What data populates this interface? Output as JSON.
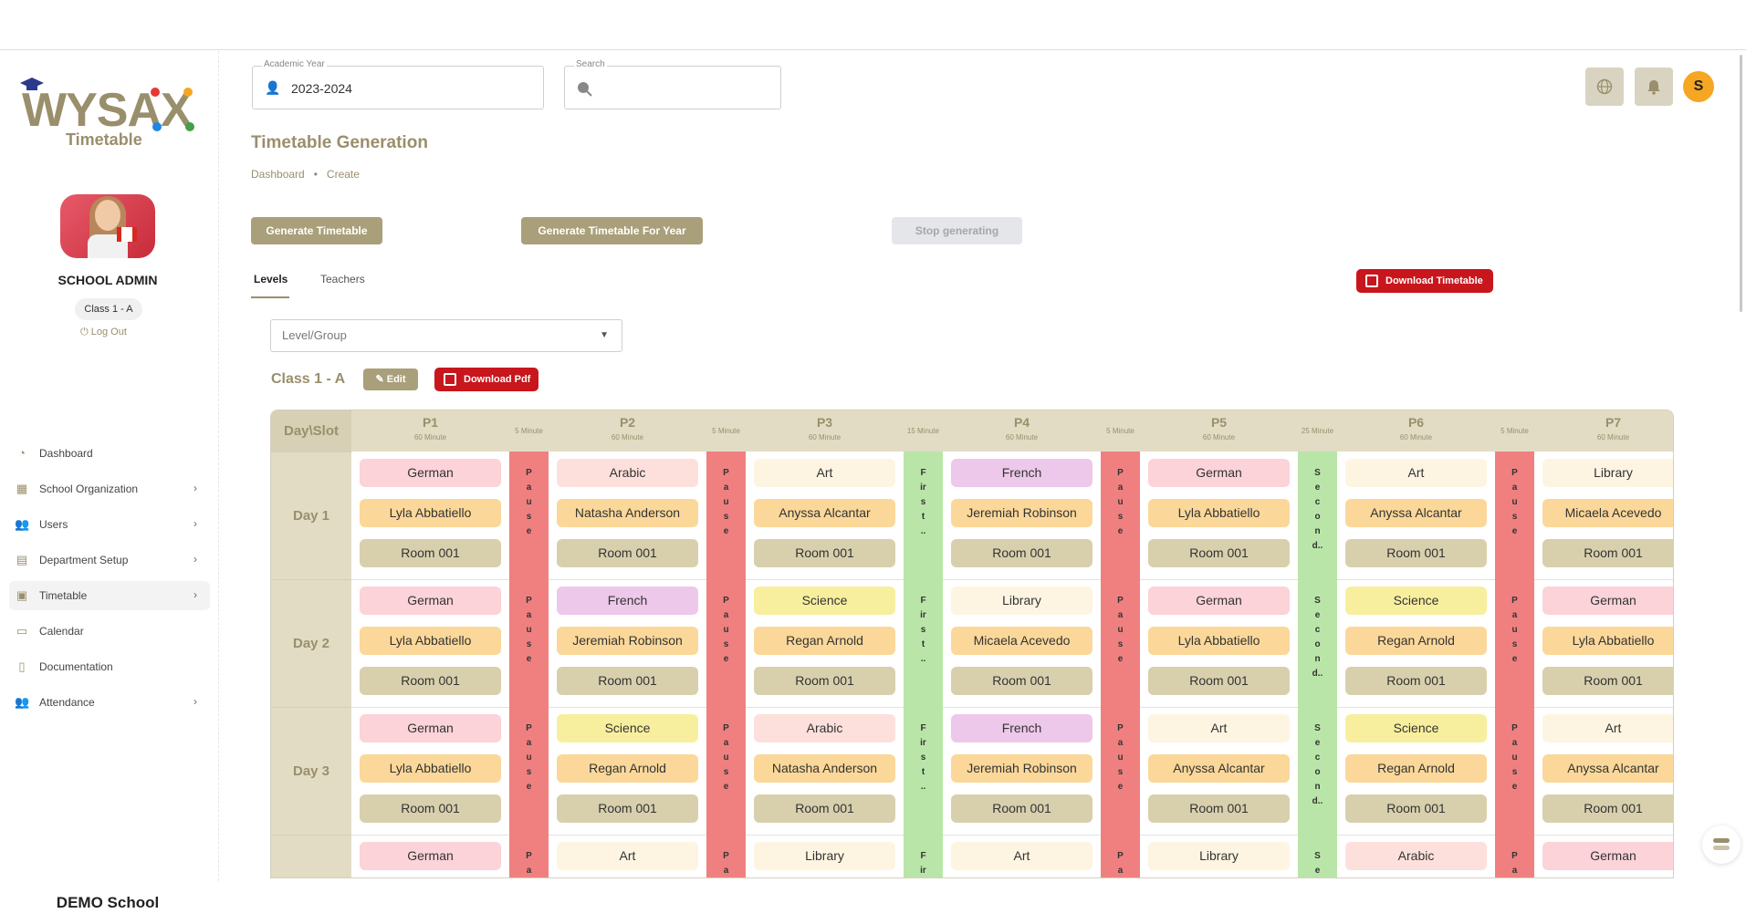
{
  "brand": {
    "logo_text": "WYSAX",
    "logo_sub": "Timetable",
    "school": "DEMO School"
  },
  "profile": {
    "role": "SCHOOL ADMIN",
    "class_chip": "Class 1 - A",
    "logout": "Log Out"
  },
  "nav": [
    {
      "label": "Dashboard",
      "icon": "dashboard-icon",
      "chevron": false
    },
    {
      "label": "School Organization",
      "icon": "building-icon",
      "chevron": true
    },
    {
      "label": "Users",
      "icon": "users-icon",
      "chevron": true
    },
    {
      "label": "Department Setup",
      "icon": "department-icon",
      "chevron": true
    },
    {
      "label": "Timetable",
      "icon": "timetable-icon",
      "chevron": true,
      "active": true
    },
    {
      "label": "Calendar",
      "icon": "calendar-icon",
      "chevron": false
    },
    {
      "label": "Documentation",
      "icon": "document-icon",
      "chevron": false
    },
    {
      "label": "Attendance",
      "icon": "attendance-icon",
      "chevron": true
    }
  ],
  "header": {
    "academic_year_label": "Academic Year",
    "academic_year_value": "2023-2024",
    "search_label": "Search",
    "avatar_initial": "S"
  },
  "page": {
    "title": "Timetable Generation",
    "breadcrumb": [
      "Dashboard",
      "Create"
    ],
    "btn_generate": "Generate Timetable",
    "btn_generate_year": "Generate Timetable For Year",
    "btn_stop": "Stop generating",
    "tabs": [
      "Levels",
      "Teachers"
    ],
    "btn_download_timetable": "Download Timetable",
    "level_select_placeholder": "Level/Group",
    "class_title": "Class 1 - A",
    "btn_edit": "Edit",
    "btn_download_pdf": "Download Pdf"
  },
  "timetable": {
    "corner": "Day\\Slot",
    "periods": [
      {
        "label": "P1",
        "duration": "60 Minute"
      },
      {
        "label": "P2",
        "duration": "60 Minute"
      },
      {
        "label": "P3",
        "duration": "60 Minute"
      },
      {
        "label": "P4",
        "duration": "60 Minute"
      },
      {
        "label": "P5",
        "duration": "60 Minute"
      },
      {
        "label": "P6",
        "duration": "60 Minute"
      },
      {
        "label": "P7",
        "duration": "60 Minute"
      }
    ],
    "breaks": [
      {
        "label": "5 Minute",
        "kind": "red",
        "text": "P a u s e"
      },
      {
        "label": "5 Minute",
        "kind": "red",
        "text": "P a u s e"
      },
      {
        "label": "15 Minute",
        "kind": "green",
        "text": "F ir s t .."
      },
      {
        "label": "5 Minute",
        "kind": "red",
        "text": "P a u s e"
      },
      {
        "label": "25 Minute",
        "kind": "green",
        "text": "S e c o n d.."
      },
      {
        "label": "5 Minute",
        "kind": "red",
        "text": "P a u s e"
      }
    ],
    "days": [
      {
        "label": "Day 1",
        "slots": [
          [
            "German",
            "Lyla Abbatiello",
            "Room 001"
          ],
          [
            "Arabic",
            "Natasha Anderson",
            "Room 001"
          ],
          [
            "Art",
            "Anyssa Alcantar",
            "Room 001"
          ],
          [
            "French",
            "Jeremiah Robinson",
            "Room 001"
          ],
          [
            "German",
            "Lyla Abbatiello",
            "Room 001"
          ],
          [
            "Art",
            "Anyssa Alcantar",
            "Room 001"
          ],
          [
            "Library",
            "Micaela Acevedo",
            "Room 001"
          ]
        ]
      },
      {
        "label": "Day 2",
        "slots": [
          [
            "German",
            "Lyla Abbatiello",
            "Room 001"
          ],
          [
            "French",
            "Jeremiah Robinson",
            "Room 001"
          ],
          [
            "Science",
            "Regan Arnold",
            "Room 001"
          ],
          [
            "Library",
            "Micaela Acevedo",
            "Room 001"
          ],
          [
            "German",
            "Lyla Abbatiello",
            "Room 001"
          ],
          [
            "Science",
            "Regan Arnold",
            "Room 001"
          ],
          [
            "German",
            "Lyla Abbatiello",
            "Room 001"
          ]
        ]
      },
      {
        "label": "Day 3",
        "slots": [
          [
            "German",
            "Lyla Abbatiello",
            "Room 001"
          ],
          [
            "Science",
            "Regan Arnold",
            "Room 001"
          ],
          [
            "Arabic",
            "Natasha Anderson",
            "Room 001"
          ],
          [
            "French",
            "Jeremiah Robinson",
            "Room 001"
          ],
          [
            "Art",
            "Anyssa Alcantar",
            "Room 001"
          ],
          [
            "Science",
            "Regan Arnold",
            "Room 001"
          ],
          [
            "Art",
            "Anyssa Alcantar",
            "Room 001"
          ]
        ]
      },
      {
        "label": "",
        "slots": [
          [
            "German"
          ],
          [
            "Art"
          ],
          [
            "Library"
          ],
          [
            "Art"
          ],
          [
            "Library"
          ],
          [
            "Arabic"
          ],
          [
            "German"
          ]
        ]
      }
    ],
    "subject_colors": {
      "German": "#fbd3d9",
      "Arabic": "#fde0dc",
      "Art": "#fdf5e1",
      "French": "#edc8ea",
      "Library": "#fdf5e1",
      "Science": "#f8ef9e"
    },
    "teacher_color": "#fbd899",
    "room_color": "#d8d0ad"
  }
}
